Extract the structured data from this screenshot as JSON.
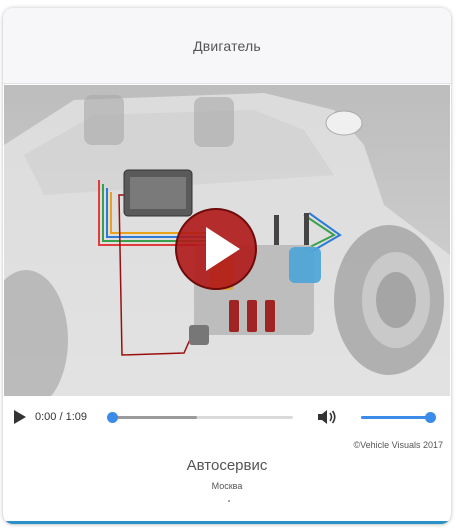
{
  "card": {
    "title": "Двигатель"
  },
  "video": {
    "scene_description_icon": "engine-cutaway-image",
    "play_overlay_icon": "play-icon",
    "play_overlay_color": "#b01818"
  },
  "player": {
    "play_icon": "play-icon",
    "current_time": "0:00",
    "separator": " / ",
    "duration": "1:09",
    "progress_fraction": 0.0,
    "buffered_fraction": 0.47,
    "volume_icon": "volume-icon",
    "volume_fraction": 1.0,
    "accent_color": "#3b8be8"
  },
  "credit": "©Vehicle Visuals 2017",
  "company": {
    "name": "Автосервис",
    "city": "Москва"
  }
}
